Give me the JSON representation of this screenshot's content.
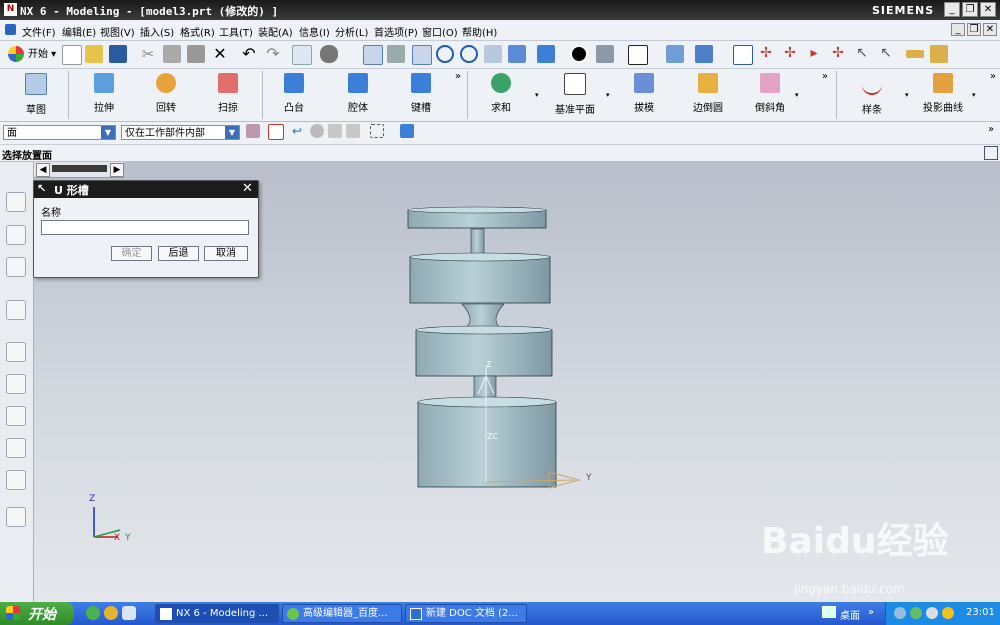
{
  "window": {
    "title": "NX 6 - Modeling - [model3.prt (修改的) ]",
    "brand": "SIEMENS",
    "logo": "N"
  },
  "menu": [
    "文件(F)",
    "编辑(E)",
    "视图(V)",
    "插入(S)",
    "格式(R)",
    "工具(T)",
    "装配(A)",
    "信息(I)",
    "分析(L)",
    "首选项(P)",
    "窗口(O)",
    "帮助(H)"
  ],
  "toolbar1": {
    "start_label": "开始"
  },
  "toolbar2": {
    "items": [
      "草图",
      "拉伸",
      "回转",
      "扫掠",
      "凸台",
      "腔体",
      "键槽",
      "求和",
      "基准平面",
      "拔模",
      "边倒圆",
      "倒斜角",
      "样条",
      "投影曲线"
    ]
  },
  "toolbar3": {
    "filter": "面",
    "scope": "仅在工作部件内部"
  },
  "cue": "选择放置面",
  "dialog": {
    "title": "U 形槽",
    "name_label": "名称",
    "name_value": "",
    "ok": "确定",
    "back": "后退",
    "cancel": "取消"
  },
  "axes": {
    "x": "X",
    "y": "Y",
    "z": "Z",
    "zc": "ZC",
    "yc": "Y"
  },
  "watermark": {
    "logo": "Baidu经验",
    "url": "jingyan.baidu.com"
  },
  "taskbar": {
    "start": "开始",
    "tasks": [
      "NX 6 - Modeling ...",
      "高级编辑器_百度...",
      "新建 DOC 文档 (2..."
    ],
    "desktop": "桌面",
    "time": "23:01"
  }
}
